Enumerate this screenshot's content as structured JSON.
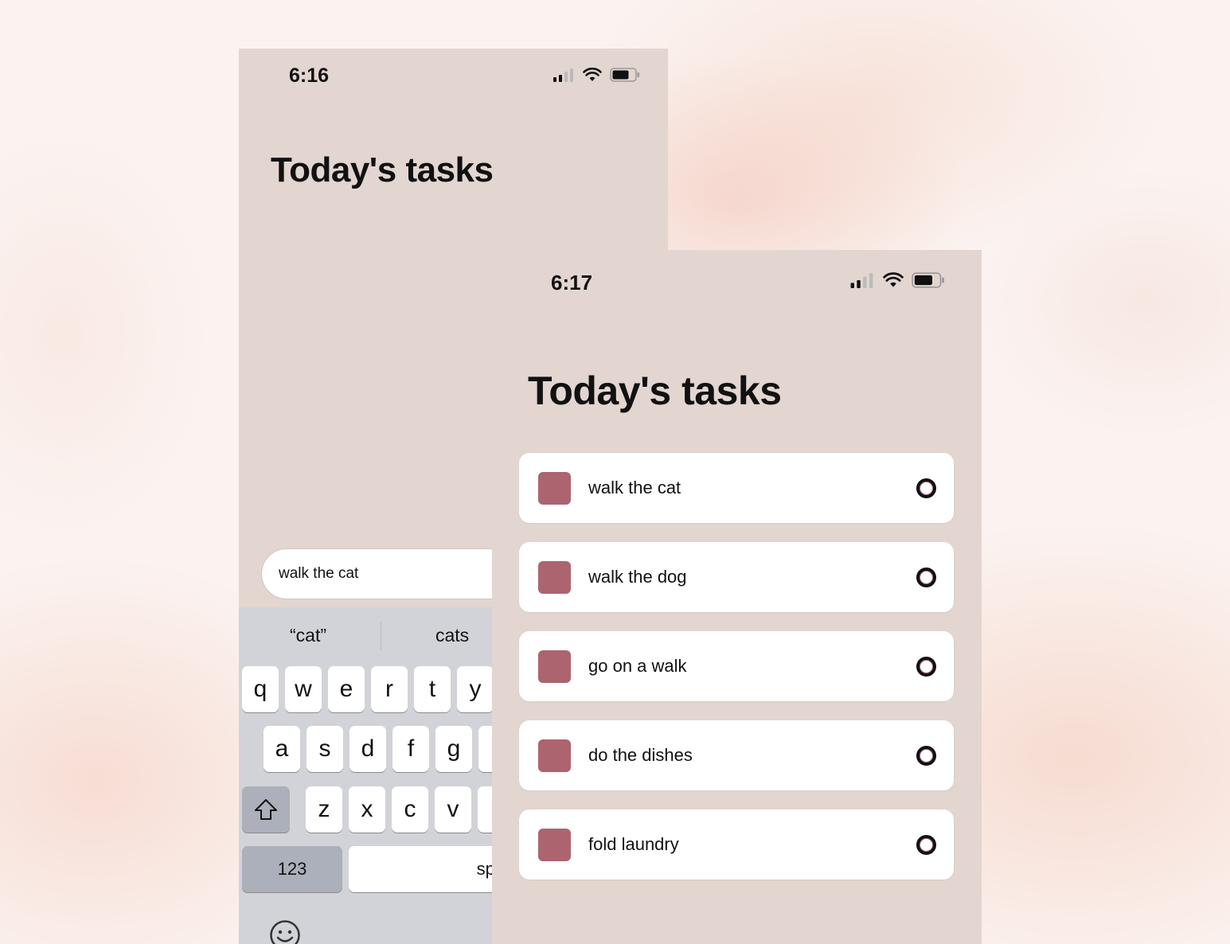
{
  "colors": {
    "phone_background": "#e3d5d0",
    "accent": "#ac646f",
    "keyboard_background": "#d1d3d9",
    "card_background": "#ffffff"
  },
  "screen_back": {
    "status": {
      "time": "6:16"
    },
    "title": "Today's tasks",
    "input": {
      "value": "walk the cat"
    },
    "keyboard": {
      "suggestions": [
        "“cat”",
        "cats"
      ],
      "row1": [
        "q",
        "w",
        "e",
        "r",
        "t",
        "y"
      ],
      "row2": [
        "a",
        "s",
        "d",
        "f",
        "g"
      ],
      "row3": [
        "z",
        "x",
        "c",
        "v"
      ],
      "numbers_key": "123",
      "space_key": "space"
    }
  },
  "screen_front": {
    "status": {
      "time": "6:17"
    },
    "title": "Today's tasks",
    "tasks": [
      {
        "label": "walk the cat"
      },
      {
        "label": "walk the dog"
      },
      {
        "label": "go on a walk"
      },
      {
        "label": "do the dishes"
      },
      {
        "label": "fold laundry"
      }
    ]
  }
}
